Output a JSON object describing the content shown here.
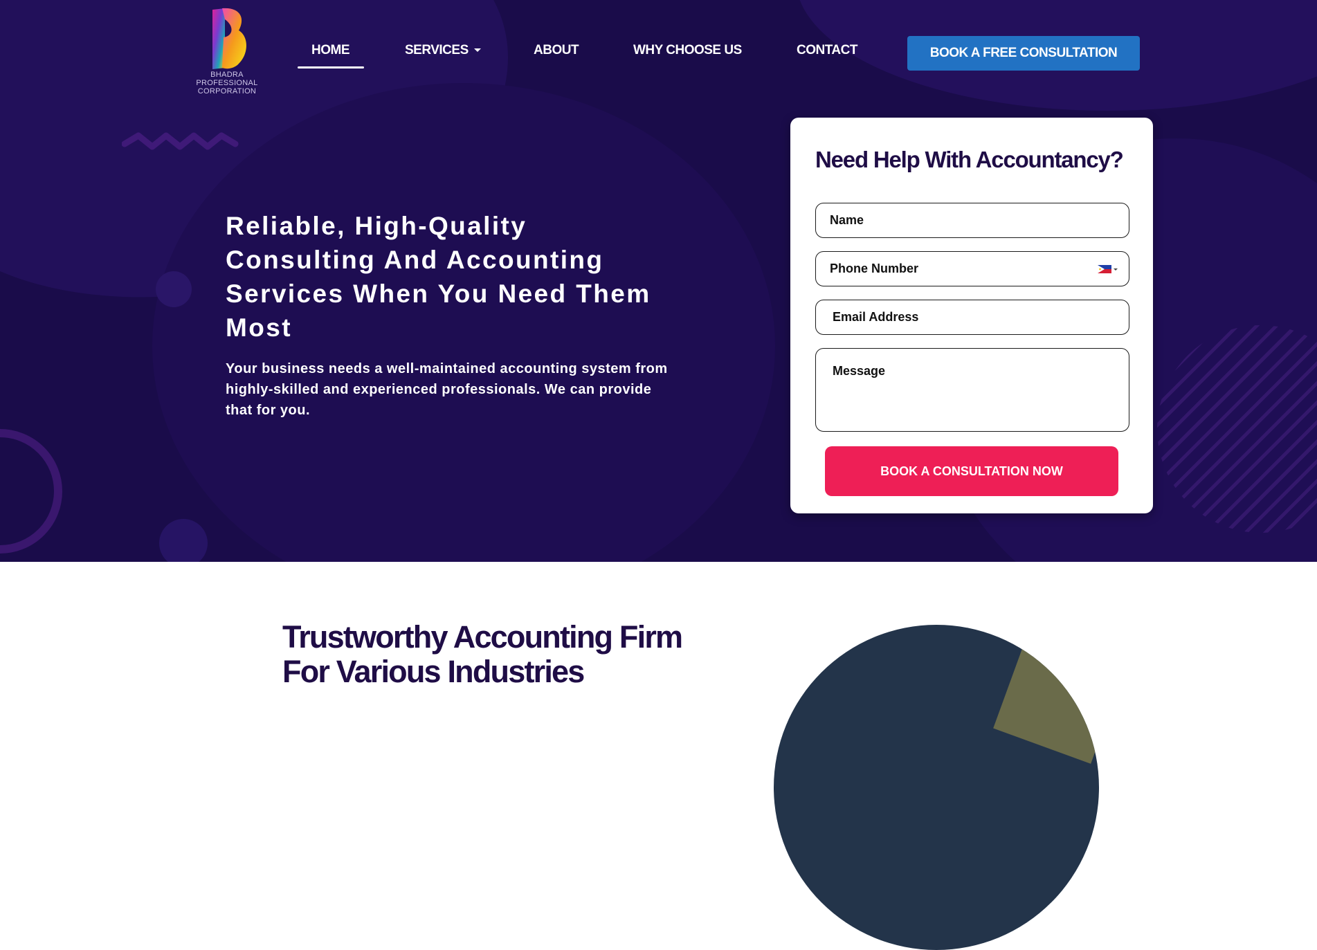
{
  "brand": {
    "line1": "BHADRA",
    "line2": "PROFESSIONAL",
    "line3": "CORPORATION"
  },
  "nav": {
    "items": [
      "HOME",
      "SERVICES",
      "ABOUT",
      "WHY CHOOSE US",
      "CONTACT"
    ],
    "active": "HOME",
    "cta": "BOOK A FREE CONSULTATION"
  },
  "hero": {
    "headline": "Reliable, High-Quality Consulting And Accounting Services When You Need Them Most",
    "subtext": "Your business needs a well-maintained accounting system from highly-skilled and experienced professionals. We can provide that for you."
  },
  "form": {
    "title": "Need Help With Accountancy?",
    "name_placeholder": "Name",
    "phone_placeholder": "Phone Number",
    "email_placeholder": "Email Address",
    "message_placeholder": "Message",
    "submit": "BOOK A CONSULTATION NOW",
    "country_flag": "ph-flag-icon"
  },
  "section": {
    "title_line1": "Trustworthy Accounting Firm",
    "title_line2": "For Various Industries"
  },
  "colors": {
    "hero_bg": "#1a0c4a",
    "cta_blue": "#2272c3",
    "submit_pink": "#ee1f56",
    "heading_dark": "#1f0d46"
  }
}
